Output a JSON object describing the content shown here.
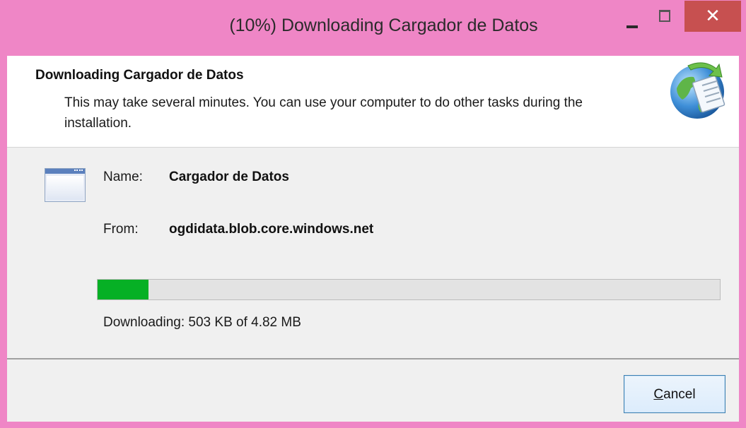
{
  "window": {
    "title": "(10%) Downloading Cargador de Datos",
    "close_glyph": "✕",
    "controls": [
      "minimize-icon",
      "maximize-icon",
      "close-icon"
    ]
  },
  "header": {
    "title": "Downloading Cargador de Datos",
    "description": "This may take several minutes. You can use your computer to do other tasks during the installation.",
    "icon": "globe-document-icon"
  },
  "details": {
    "name_label": "Name:",
    "name_value": "Cargador de Datos",
    "from_label": "From:",
    "from_value": "ogdidata.blob.core.windows.net",
    "app_icon": "application-window-icon"
  },
  "progress": {
    "fraction": 0.082,
    "status": "Downloading: 503 KB of 4.82 MB"
  },
  "footer": {
    "cancel_accel": "C",
    "cancel_rest": "ancel"
  },
  "colors": {
    "frame": "#ef86c6",
    "close_button": "#c75050",
    "progress_fill": "#06b025"
  }
}
